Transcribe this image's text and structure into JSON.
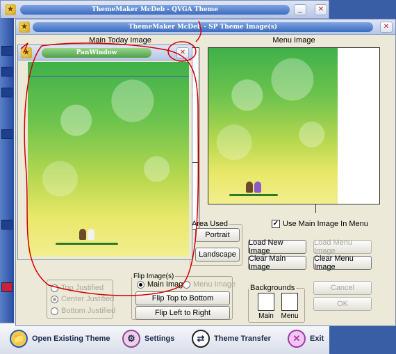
{
  "back_window": {
    "title": "ThemeMaker McDeb - QVGA Theme",
    "icon": "app-icon",
    "minimize": "_",
    "close": "✕",
    "bottom_bar": [
      {
        "label": "Open Existing Theme",
        "icon": "folder-icon"
      },
      {
        "label": "Settings",
        "icon": "settings-icon"
      },
      {
        "label": "Theme Transfer",
        "icon": "transfer-icon"
      },
      {
        "label": "Exit",
        "icon": "exit-icon"
      }
    ]
  },
  "front_window": {
    "title": "ThemeMaker McDeb - SP Theme Image(s)",
    "close": "✕",
    "main_today_image_label": "Main Today Image",
    "menu_image_label": "Menu Image",
    "area_used": {
      "legend": "Area Used",
      "portrait": "Portrait",
      "landscape": "Landscape"
    },
    "use_main_image_in_menu": {
      "label": "Use Main Image In Menu",
      "checked": true
    },
    "buttons": {
      "load_new_image": "Load New Image",
      "load_menu_image": "Load Menu Image",
      "clear_main_image": "Clear Main Image",
      "clear_menu_image": "Clear Menu Image",
      "cancel": "Cancel",
      "ok": "OK"
    },
    "justify": {
      "options": [
        "Top Justified",
        "Center Justified",
        "Bottom Justified"
      ],
      "selected": "Center Justified"
    },
    "flip": {
      "legend": "Flip Image(s)",
      "main_image": "Main Image",
      "menu_image": "Menu Image",
      "flip_top_to_bottom": "Flip Top to Bottom",
      "flip_left_to_right": "Flip Left to Right"
    },
    "backgrounds": {
      "legend": "Backgrounds",
      "main": "Main",
      "menu": "Menu"
    }
  },
  "pan_window": {
    "title": "PanWindow",
    "close": "✕"
  },
  "colors": {
    "annotation": "#d40000",
    "title_pill": "#3d6cc0"
  }
}
